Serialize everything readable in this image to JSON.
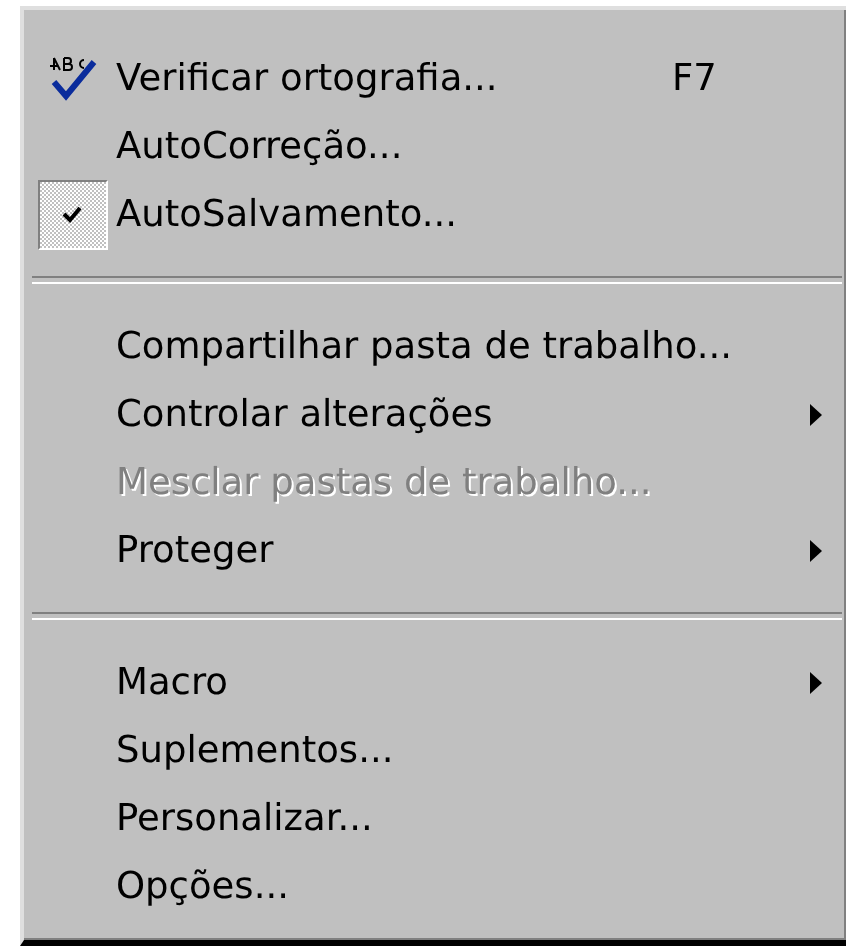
{
  "menu": {
    "groups": [
      {
        "items": [
          {
            "label": "Verificar ortografia...",
            "shortcut": "F7",
            "kind": "spell",
            "checked": false,
            "disabled": false,
            "submenu": false
          },
          {
            "label": "AutoCorreção...",
            "kind": "plain",
            "checked": false,
            "disabled": false,
            "submenu": false
          },
          {
            "label": "AutoSalvamento...",
            "kind": "plain",
            "checked": true,
            "disabled": false,
            "submenu": false
          }
        ]
      },
      {
        "items": [
          {
            "label": "Compartilhar pasta de trabalho...",
            "kind": "plain",
            "checked": false,
            "disabled": false,
            "submenu": false
          },
          {
            "label": "Controlar alterações",
            "kind": "plain",
            "checked": false,
            "disabled": false,
            "submenu": true
          },
          {
            "label": "Mesclar pastas de trabalho...",
            "kind": "plain",
            "checked": false,
            "disabled": true,
            "submenu": false
          },
          {
            "label": "Proteger",
            "kind": "plain",
            "checked": false,
            "disabled": false,
            "submenu": true
          }
        ]
      },
      {
        "items": [
          {
            "label": "Macro",
            "kind": "plain",
            "checked": false,
            "disabled": false,
            "submenu": true
          },
          {
            "label": "Suplementos...",
            "kind": "plain",
            "checked": false,
            "disabled": false,
            "submenu": false
          },
          {
            "label": "Personalizar...",
            "kind": "plain",
            "checked": false,
            "disabled": false,
            "submenu": false
          },
          {
            "label": "Opções...",
            "kind": "plain",
            "checked": false,
            "disabled": false,
            "submenu": false
          }
        ]
      }
    ]
  }
}
